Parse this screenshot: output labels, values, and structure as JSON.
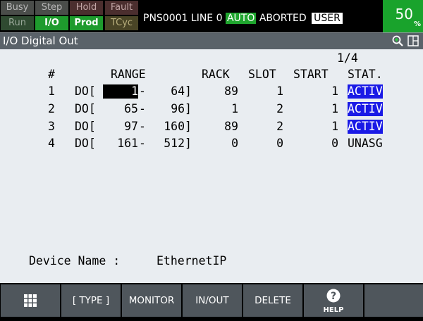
{
  "indicators": [
    {
      "label": "Busy",
      "state": "off"
    },
    {
      "label": "Step",
      "state": "off"
    },
    {
      "label": "Hold",
      "state": "off"
    },
    {
      "label": "Fault",
      "state": "off"
    },
    {
      "label": "Run",
      "state": "off"
    },
    {
      "label": "I/O",
      "state": "on"
    },
    {
      "label": "Prod",
      "state": "on"
    },
    {
      "label": "TCyc",
      "state": "off"
    }
  ],
  "status": {
    "program": "PNS0001",
    "line": "LINE 0",
    "mode": "AUTO",
    "state": "ABORTED",
    "user": "USER"
  },
  "speed": {
    "value": "50",
    "unit": "%"
  },
  "title": "I/O Digital Out",
  "page": "1/4",
  "columns": {
    "num": "#",
    "range": "RANGE",
    "rack": "RACK",
    "slot": "SLOT",
    "start": "START",
    "stat": "STAT."
  },
  "rows": [
    {
      "num": "1",
      "prefix": "DO[",
      "from": "1",
      "to": "64]",
      "rack": "89",
      "slot": "1",
      "start": "1",
      "stat": "ACTIV"
    },
    {
      "num": "2",
      "prefix": "DO[",
      "from": "65",
      "to": "96]",
      "rack": "1",
      "slot": "2",
      "start": "1",
      "stat": "ACTIV"
    },
    {
      "num": "3",
      "prefix": "DO[",
      "from": "97",
      "to": "160]",
      "rack": "89",
      "slot": "2",
      "start": "1",
      "stat": "ACTIV"
    },
    {
      "num": "4",
      "prefix": "DO[",
      "from": "161",
      "to": "512]",
      "rack": "0",
      "slot": "0",
      "start": "0",
      "stat": "UNASG"
    }
  ],
  "device": {
    "label": "Device Name :",
    "value": "EthernetIP"
  },
  "fkeys": {
    "type": "[ TYPE ]",
    "monitor": "MONITOR",
    "inout": "IN/OUT",
    "delete": "DELETE",
    "help": "HELP"
  },
  "icons": {
    "zoom": "zoom-in-icon",
    "layout": "window-layout-icon",
    "menu": "grid-menu-icon",
    "help": "help-icon"
  }
}
